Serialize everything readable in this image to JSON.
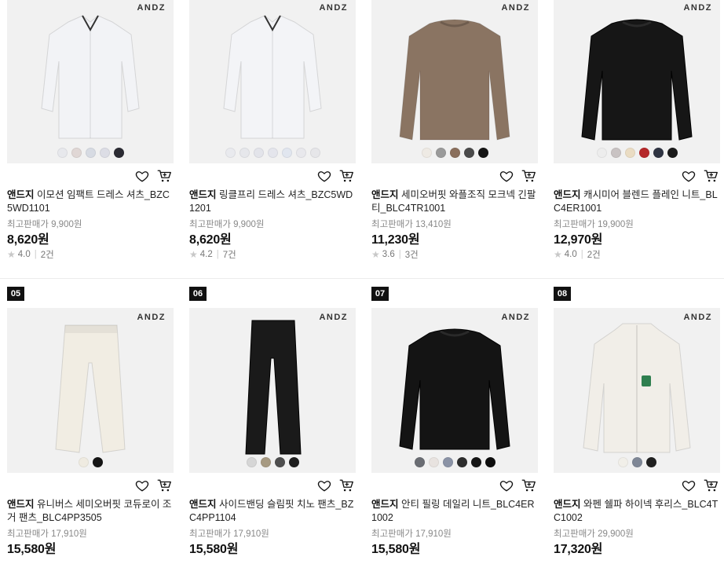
{
  "products": [
    {
      "brand_mark": "ANDZ",
      "brand": "앤드지",
      "title": "이모션 임팩트 드레스 셔츠_BZC5WD1101",
      "orig_price": "최고판매가 9,900원",
      "price": "8,620원",
      "rating": "4.0",
      "reviews": "2건",
      "garment": "shirt",
      "garment_color": "#f2f3f6",
      "swatches": [
        "#e7e8ec",
        "#e0d7d5",
        "#d7dbe3",
        "#dcdde5",
        "#2b2b33"
      ]
    },
    {
      "brand_mark": "ANDZ",
      "brand": "앤드지",
      "title": "링클프리 드레스 셔츠_BZC5WD1201",
      "orig_price": "최고판매가 9,900원",
      "price": "8,620원",
      "rating": "4.2",
      "reviews": "7건",
      "garment": "shirt",
      "garment_color": "#f3f4f7",
      "swatches": [
        "#e9eaee",
        "#e6e7eb",
        "#e3e4ea",
        "#e4e5ec",
        "#e1e6ef",
        "#e8e8ec",
        "#e6e6e9"
      ]
    },
    {
      "brand_mark": "ANDZ",
      "brand": "앤드지",
      "title": "세미오버핏 와플조직 모크넥 긴팔티_BLC4TR1001",
      "orig_price": "최고판매가 13,410원",
      "price": "11,230원",
      "rating": "3.6",
      "reviews": "3건",
      "garment": "sweater",
      "garment_color": "#8a7462",
      "swatches": [
        "#eeeae4",
        "#9a9a9a",
        "#8a6f5c",
        "#4a4a4a",
        "#151515"
      ]
    },
    {
      "brand_mark": "ANDZ",
      "brand": "앤드지",
      "title": "캐시미어 블렌드 플레인 니트_BLC4ER1001",
      "orig_price": "최고판매가 19,900원",
      "price": "12,970원",
      "rating": "4.0",
      "reviews": "2건",
      "garment": "sweater",
      "garment_color": "#161616",
      "swatches": [
        "#ededed",
        "#c9c3c3",
        "#eadcc3",
        "#b5282a",
        "#2f3442",
        "#1a1a1a"
      ]
    },
    {
      "rank": "05",
      "brand_mark": "ANDZ",
      "brand": "앤드지",
      "title": "유니버스 세미오버핏 코듀로이 조거 팬츠_BLC4PP3505",
      "orig_price": "최고판매가 17,910원",
      "price": "15,580원",
      "garment": "jogger",
      "garment_color": "#f1ede3",
      "swatches": [
        "#efebe1",
        "#151515"
      ]
    },
    {
      "rank": "06",
      "brand_mark": "ANDZ",
      "brand": "앤드지",
      "title": "사이드밴딩 슬림핏 치노 팬츠_BZC4PP1104",
      "orig_price": "최고판매가 17,910원",
      "price": "15,580원",
      "garment": "pants",
      "garment_color": "#1a1a1a",
      "swatches": [
        "#d6d6d6",
        "#a79a82",
        "#4e4e4e",
        "#1e1e1e"
      ]
    },
    {
      "rank": "07",
      "brand_mark": "ANDZ",
      "brand": "앤드지",
      "title": "안티 필링 데일리 니트_BLC4ER1002",
      "orig_price": "최고판매가 17,910원",
      "price": "15,580원",
      "garment": "sweater",
      "garment_color": "#141414",
      "swatches": [
        "#6a6d73",
        "#e8e3e0",
        "#8b93a6",
        "#2d2d2d",
        "#161616",
        "#0e0e0e"
      ]
    },
    {
      "rank": "08",
      "brand_mark": "ANDZ",
      "brand": "앤드지",
      "title": "와펜 쉘파 하이넥 후리스_BLC4TC1002",
      "orig_price": "최고판매가 29,900원",
      "price": "17,320원",
      "garment": "fleece",
      "garment_color": "#f1eee8",
      "swatches": [
        "#f1efe9",
        "#7f8796",
        "#202020"
      ]
    }
  ],
  "icons": {
    "wishlist": "heart-icon",
    "cart": "cart-icon",
    "rating": "star-icon"
  },
  "colors": {
    "rank_badge": "#111111",
    "image_bg": "#f1f1f1",
    "muted_text": "#888888"
  }
}
